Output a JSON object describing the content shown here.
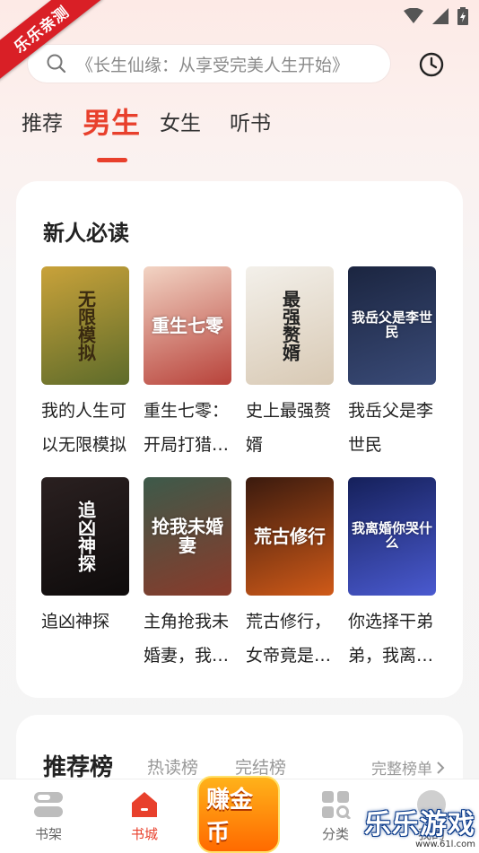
{
  "corner_ribbon": "乐乐亲测",
  "search": {
    "placeholder": "《长生仙缘：从享受完美人生开始》"
  },
  "tabs": [
    {
      "label": "推荐",
      "active": false
    },
    {
      "label": "男生",
      "active": true
    },
    {
      "label": "女生",
      "active": false
    },
    {
      "label": "听书",
      "active": false
    }
  ],
  "new_reader_section": {
    "title": "新人必读",
    "books": [
      {
        "name": "我的人生可以无限模拟",
        "cover_title": "无限模拟",
        "cover_colors": [
          "#c9a23a",
          "#5d6b2a"
        ]
      },
      {
        "name": "重生七零：开局打猎养家",
        "cover_title": "重生七零",
        "cover_colors": [
          "#f2d4c4",
          "#b8423a"
        ]
      },
      {
        "name": "史上最强赘婿",
        "cover_title": "最强赘婿",
        "cover_colors": [
          "#f3f0ea",
          "#d8c9b4"
        ]
      },
      {
        "name": "我岳父是李世民",
        "cover_title": "我岳父是李世民",
        "cover_colors": [
          "#1b2540",
          "#3a4b78"
        ]
      },
      {
        "name": "追凶神探",
        "cover_title": "追凶神探",
        "cover_colors": [
          "#2a2020",
          "#0e0b0b"
        ]
      },
      {
        "name": "主角抢我未婚妻，我反手偷他家",
        "cover_title": "抢我未婚妻",
        "cover_colors": [
          "#3d5a4a",
          "#8a3a2a"
        ]
      },
      {
        "name": "荒古修行，女帝竟是我身边女仆",
        "cover_title": "荒古修行",
        "cover_colors": [
          "#3a1a0e",
          "#d05a18"
        ]
      },
      {
        "name": "你选择干弟弟，我离婚你哭什么",
        "cover_title": "我离婚你哭什么",
        "cover_colors": [
          "#15205a",
          "#4a5ad0"
        ]
      }
    ]
  },
  "rank_section": {
    "tabs": [
      {
        "label": "推荐榜",
        "active": true
      },
      {
        "label": "热读榜",
        "active": false
      },
      {
        "label": "完结榜",
        "active": false
      }
    ],
    "more_label": "完整榜单"
  },
  "bottom_nav": [
    {
      "label": "书架",
      "icon": "bookshelf-icon",
      "active": false
    },
    {
      "label": "书城",
      "icon": "store-icon",
      "active": true
    },
    {
      "label": "赚金币",
      "icon": "coin-icon",
      "active": false
    },
    {
      "label": "分类",
      "icon": "category-icon",
      "active": false
    },
    {
      "label": "我的",
      "icon": "profile-icon",
      "active": false
    }
  ],
  "watermark": {
    "main": "乐乐游戏",
    "sub": "www.61l.com"
  },
  "colors": {
    "accent": "#e8402c"
  }
}
